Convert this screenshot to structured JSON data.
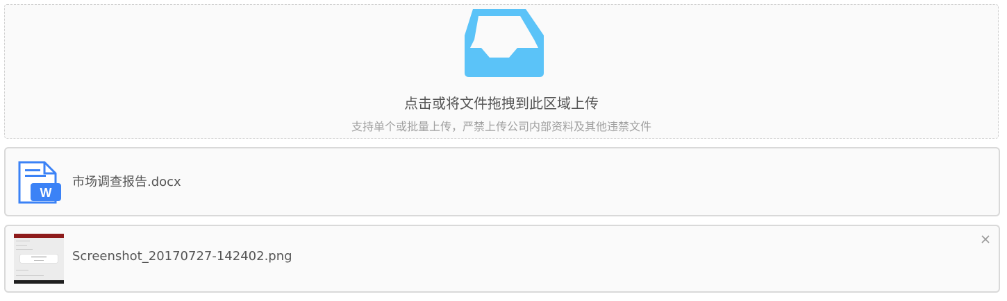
{
  "upload": {
    "icon": "inbox-icon",
    "title": "点击或将文件拖拽到此区域上传",
    "hint": "支持单个或批量上传，严禁上传公司内部资料及其他违禁文件",
    "accent_color": "#5bc3f8"
  },
  "files": [
    {
      "name": "市场调查报告.docx",
      "icon": "word-file-icon",
      "icon_color": "#3b82f6"
    },
    {
      "name": "Screenshot_20170727-142402.png",
      "icon": "image-thumbnail",
      "remove_icon": "close-icon"
    }
  ]
}
